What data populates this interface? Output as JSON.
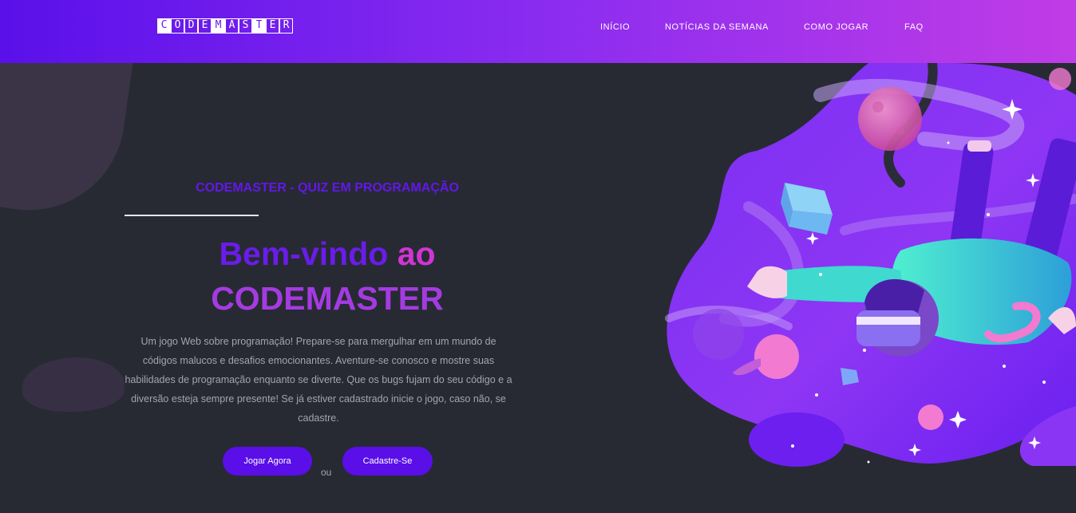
{
  "header": {
    "logo_letters": [
      "C",
      "O",
      "D",
      "E",
      "M",
      "A",
      "S",
      "T",
      "E",
      "R"
    ],
    "nav": [
      {
        "label": "INÍCIO"
      },
      {
        "label": "NOTÍCIAS DA SEMANA"
      },
      {
        "label": "COMO JOGAR"
      },
      {
        "label": "FAQ"
      }
    ]
  },
  "hero": {
    "subtitle": "CODEMASTER - QUIZ EM PROGRAMAÇÃO",
    "headline_part1": "Bem-vindo",
    "headline_part2": "ao",
    "headline_part3": "CODEMASTER",
    "description": "Um jogo Web sobre programação! Prepare-se para mergulhar em um mundo de códigos malucos e desafios emocionantes. Aventure-se conosco e mostre suas habilidades de programação enquanto se diverte. Que os bugs fujam do seu código e a diversão esteja sempre presente! Se já estiver cadastrado inicie o jogo, caso não, se cadastre.",
    "play_button": "Jogar Agora",
    "or_text": "ou",
    "signup_button": "Cadastre-Se"
  },
  "colors": {
    "header_gradient_start": "#5a10ea",
    "header_gradient_end": "#c03ce6",
    "page_background": "#272a33",
    "accent_purple": "#6a1ce9",
    "accent_pink": "#d035d4",
    "button": "#5a0ee8"
  },
  "illustration": {
    "icon": "vr-astronaut-space-illustration"
  }
}
